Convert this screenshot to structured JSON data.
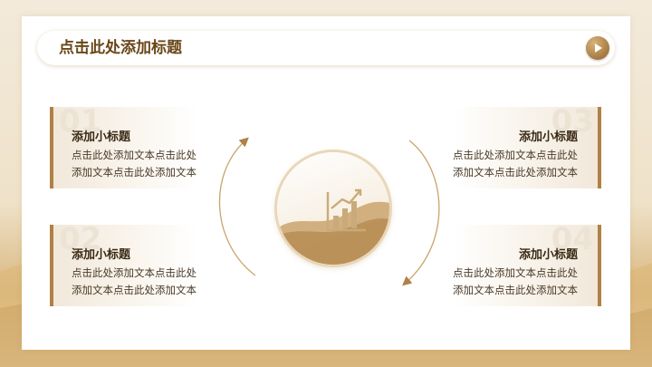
{
  "title": "点击此处添加标题",
  "cards": [
    {
      "num": "01",
      "title": "添加小标题",
      "line1": "点击此处添加文本点击此处",
      "line2": "添加文本点击此处添加文本"
    },
    {
      "num": "02",
      "title": "添加小标题",
      "line1": "点击此处添加文本点击此处",
      "line2": "添加文本点击此处添加文本"
    },
    {
      "num": "03",
      "title": "添加小标题",
      "line1": "点击此处添加文本点击此处",
      "line2": "添加文本点击此处添加文本"
    },
    {
      "num": "04",
      "title": "添加小标题",
      "line1": "点击此处添加文本点击此处",
      "line2": "添加文本点击此处添加文本"
    }
  ],
  "icons": {
    "center": "bar-chart-growth-icon",
    "action": "play-icon"
  },
  "colors": {
    "accent": "#b08145",
    "title": "#6a4718",
    "text": "#4a3a28"
  }
}
